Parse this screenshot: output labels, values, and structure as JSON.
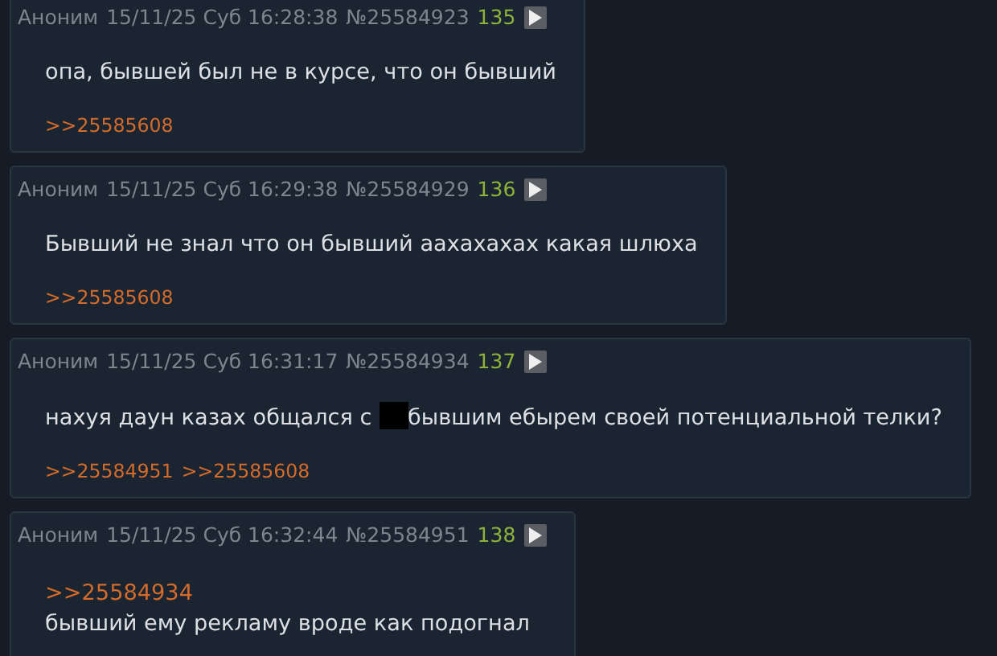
{
  "posts": [
    {
      "author": "Аноним",
      "date": "15/11/25 Суб 16:28:38",
      "number": "№25584923",
      "index": "135",
      "lines": [
        [
          {
            "kind": "text",
            "text": "опа, бывшей был не в курсе, что он бывший"
          }
        ]
      ],
      "backlinks": [
        ">>25585608"
      ]
    },
    {
      "author": "Аноним",
      "date": "15/11/25 Суб 16:29:38",
      "number": "№25584929",
      "index": "136",
      "lines": [
        [
          {
            "kind": "text",
            "text": "Бывший не знал что он бывший аахахахах какая шлюха"
          }
        ]
      ],
      "backlinks": [
        ">>25585608"
      ]
    },
    {
      "author": "Аноним",
      "date": "15/11/25 Суб 16:31:17",
      "number": "№25584934",
      "index": "137",
      "lines": [
        [
          {
            "kind": "text",
            "text": "нахуя даун казах общался с "
          },
          {
            "kind": "redaction"
          },
          {
            "kind": "text",
            "text": "бывшим ебырем своей потенциальной телки?"
          }
        ]
      ],
      "backlinks": [
        ">>25584951",
        ">>25585608"
      ]
    },
    {
      "author": "Аноним",
      "date": "15/11/25 Суб 16:32:44",
      "number": "№25584951",
      "index": "138",
      "lines": [
        [
          {
            "kind": "link",
            "text": ">>25584934"
          }
        ],
        [
          {
            "kind": "text",
            "text": "бывший ему рекламу вроде как подогнал"
          }
        ]
      ]
    }
  ]
}
